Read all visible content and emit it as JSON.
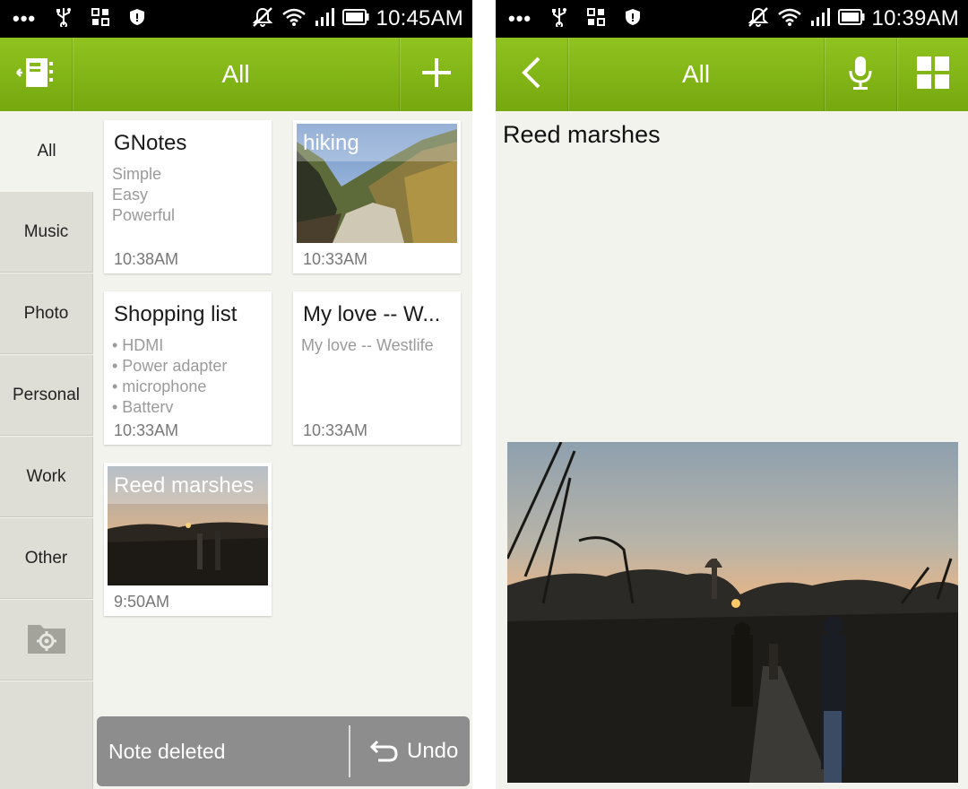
{
  "left_phone": {
    "status_bar": {
      "time": "10:45AM",
      "overflow": "•••",
      "icons": [
        "usb-icon",
        "app-grid-icon",
        "shield-icon",
        "mute-icon",
        "wifi-icon",
        "signal-icon",
        "battery-icon"
      ]
    },
    "action_bar": {
      "title": "All",
      "left_icon": "notebook-icon",
      "right_icon": "plus-icon"
    },
    "sidebar": {
      "categories": [
        {
          "label": "All",
          "active": true
        },
        {
          "label": "Music",
          "active": false
        },
        {
          "label": "Photo",
          "active": false
        },
        {
          "label": "Personal",
          "active": false
        },
        {
          "label": "Work",
          "active": false
        },
        {
          "label": "Other",
          "active": false
        }
      ],
      "settings_icon": "folder-settings-icon"
    },
    "notes": [
      {
        "title": "GNotes",
        "lines": [
          "Simple",
          "Easy",
          "Powerful"
        ],
        "time": "10:38AM"
      },
      {
        "title": "hiking",
        "type": "photo",
        "time": "10:33AM"
      },
      {
        "title": "Shopping list",
        "lines": [
          "• HDMI",
          "• Power adapter",
          "• microphone",
          "• Batterv"
        ],
        "time": "10:33AM"
      },
      {
        "title": "My love -- W...",
        "lines": [
          "My love -- Westlife"
        ],
        "time": "10:33AM"
      },
      {
        "title": "Reed marshes",
        "type": "photo",
        "time": "9:50AM"
      }
    ],
    "snackbar": {
      "message": "Note deleted",
      "action": "Undo"
    }
  },
  "right_phone": {
    "status_bar": {
      "time": "10:39AM",
      "overflow": "•••"
    },
    "action_bar": {
      "title": "All",
      "icons": [
        "back-icon",
        "microphone-icon",
        "grid-view-icon"
      ]
    },
    "note": {
      "title": "Reed marshes"
    }
  },
  "colors": {
    "accent_green": "#84b817",
    "background": "#f3f3ee",
    "sidebar_tab": "#deded6",
    "snackbar": "#8d8d8d"
  }
}
